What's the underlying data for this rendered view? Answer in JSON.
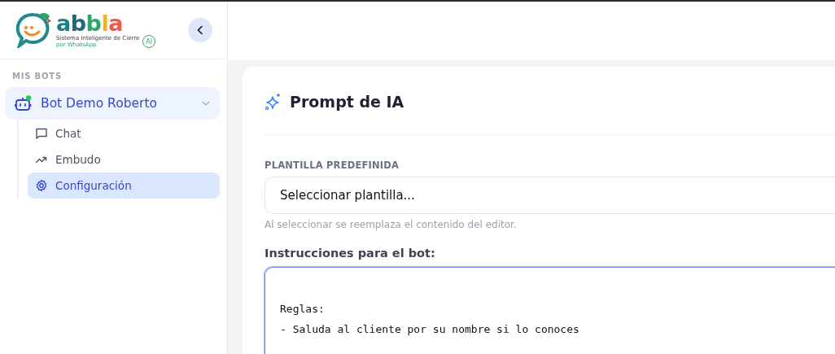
{
  "brand": {
    "name": "abbla",
    "tagline_1": "Sistema Inteligente de Cierre",
    "tagline_2": "por WhatsApp",
    "badge": "AI"
  },
  "sidebar": {
    "section_title": "MIS BOTS",
    "bot": {
      "name": "Bot Demo Roberto",
      "online": true,
      "expanded": true,
      "selected": false
    },
    "items": [
      {
        "label": "Chat",
        "kind": "chat",
        "selected": false
      },
      {
        "label": "Embudo",
        "kind": "trend",
        "selected": false
      },
      {
        "label": "Configuración",
        "kind": "settings",
        "selected": true
      }
    ]
  },
  "card": {
    "title": "Prompt de IA",
    "template_label": "PLANTILLA PREDEFINIDA",
    "template_select": {
      "placeholder": "Seleccionar plantilla..."
    },
    "template_hint": "Al seleccionar se reemplaza el contenido del editor.",
    "instructions_label": "Instrucciones para el bot:",
    "instructions": {
      "value": "Reglas:\n- Saluda al cliente por su nombre si lo conoces",
      "focused": true
    }
  }
}
